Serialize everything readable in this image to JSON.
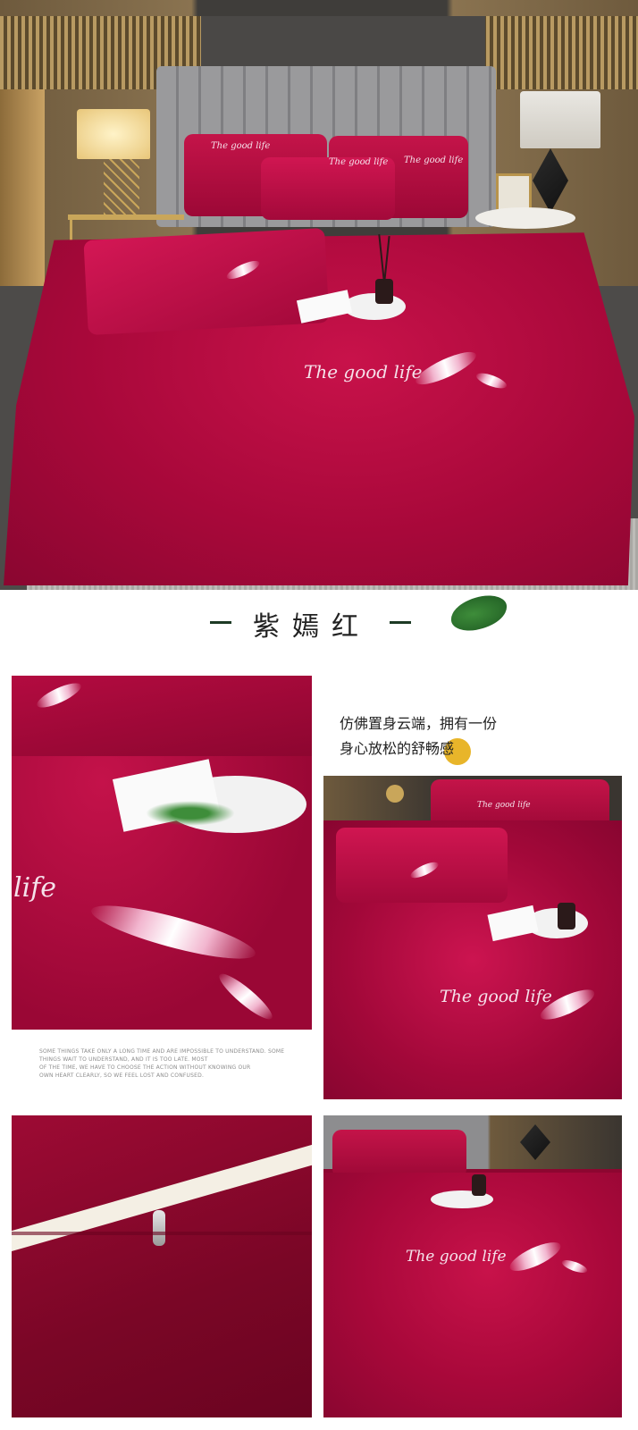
{
  "hero": {
    "embroidery_main": "The good life",
    "embroidery_pillow": "The good life",
    "embroidery_sham": "The good life"
  },
  "section": {
    "color_name": "紫嫣红"
  },
  "detail1": {
    "embroidery": "life"
  },
  "copy": {
    "cn_line1": "仿佛置身云端，拥有一份",
    "cn_line2": "身心放松的舒畅感",
    "en_line1": "SOME THINGS TAKE ONLY A LONG TIME AND ARE IMPOSSIBLE TO UNDERSTAND. SOME",
    "en_line2": "THINGS WAIT TO UNDERSTAND, AND IT IS TOO LATE. MOST",
    "en_line3": "OF THE TIME, WE HAVE TO CHOOSE THE ACTION WITHOUT KNOWING OUR",
    "en_line4": "OWN HEART CLEARLY, SO WE FEEL LOST AND CONFUSED."
  },
  "detail2": {
    "embroidery": "The good life",
    "pillow_embroidery": "The good life"
  },
  "detail4": {
    "embroidery": "The good life"
  },
  "colors": {
    "duvet": "#a8083a",
    "accent_dot": "#e8b52a",
    "title_dash": "#1d3a25"
  }
}
